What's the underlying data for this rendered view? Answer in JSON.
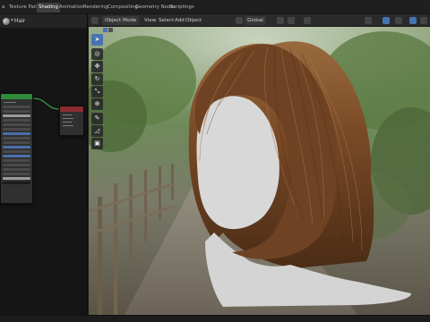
{
  "workspace_tabs": [
    {
      "label": "a",
      "active": false
    },
    {
      "label": "Texture Paint",
      "active": false
    },
    {
      "label": "Shading",
      "active": true
    },
    {
      "label": "Animation",
      "active": false
    },
    {
      "label": "Rendering",
      "active": false
    },
    {
      "label": "Compositing",
      "active": false
    },
    {
      "label": "Geometry Nodes",
      "active": false
    },
    {
      "label": "Scripting",
      "active": false
    },
    {
      "label": "+",
      "active": false
    }
  ],
  "node_editor": {
    "material_name": "Hair"
  },
  "viewport_header": {
    "mode": "Object Mode",
    "menu_view": "View",
    "menu_select": "Select",
    "menu_add": "Add",
    "menu_object": "Object",
    "transform_orientation": "Global"
  },
  "tools": [
    {
      "name": "select-tool-icon",
      "glyph": "➤",
      "active": true
    },
    {
      "name": "cursor-tool-icon",
      "glyph": "◎",
      "active": false
    },
    {
      "name": "move-tool-icon",
      "glyph": "✥",
      "active": false
    },
    {
      "name": "rotate-tool-icon",
      "glyph": "↻",
      "active": false
    },
    {
      "name": "scale-tool-icon",
      "glyph": "⤡",
      "active": false
    },
    {
      "name": "transform-tool-icon",
      "glyph": "⊕",
      "active": false
    },
    {
      "name": "annotate-tool-icon",
      "glyph": "✎",
      "active": false
    },
    {
      "name": "measure-tool-icon",
      "glyph": "◿",
      "active": false
    },
    {
      "name": "add-cube-tool-icon",
      "glyph": "▣",
      "active": false
    }
  ],
  "colors": {
    "accent": "#4772b3",
    "active_tab": "#3f3f3f",
    "bsdf_header": "#2f8a3a",
    "output_header": "#8a2c30",
    "hair": "#7a4a26",
    "mannequin": "#d4d4d4"
  }
}
